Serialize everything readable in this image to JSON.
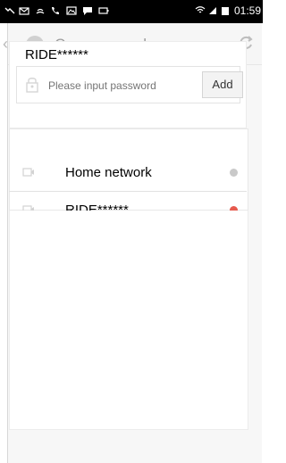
{
  "status_bar": {
    "time": "01:59",
    "left_icons": [
      "missed-call-icon",
      "mail-icon",
      "cast-icon",
      "phone-icon",
      "gallery-icon",
      "chat-icon",
      "battery-icon"
    ],
    "right_icons": [
      "wifi-icon",
      "signal-icon",
      "battery-icon"
    ]
  },
  "header": {
    "title": "Camera nearby"
  },
  "password_card": {
    "ssid": "RIDE******",
    "placeholder": "Please input password",
    "add_label": "Add"
  },
  "networks": [
    {
      "label": "Home network",
      "status_color": "#c9c9c9"
    },
    {
      "label": "RIDE******",
      "status_color": "#e65a4e"
    }
  ],
  "colors": {
    "accent_red": "#e65a4e",
    "muted_gray": "#c9c9c9"
  }
}
